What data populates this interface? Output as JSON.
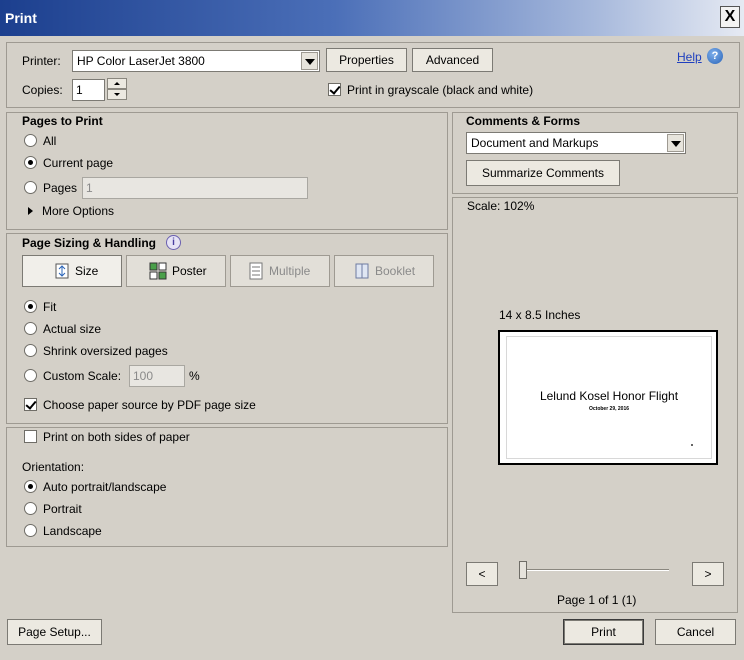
{
  "window": {
    "title": "Print",
    "close_glyph": "X"
  },
  "header": {
    "printer_label": "Printer:",
    "printer_value": "HP Color LaserJet 3800",
    "properties_label": "Properties",
    "advanced_label": "Advanced",
    "help_label": "Help",
    "help_glyph": "?",
    "copies_label": "Copies:",
    "copies_value": "1",
    "grayscale_label": "Print in grayscale (black and white)",
    "grayscale_checked": true
  },
  "pages_to_print": {
    "title": "Pages to Print",
    "options": [
      {
        "label": "All",
        "selected": false
      },
      {
        "label": "Current page",
        "selected": true
      },
      {
        "label": "Pages",
        "selected": false
      }
    ],
    "pages_value": "1",
    "more_options_label": "More Options"
  },
  "page_sizing": {
    "title": "Page Sizing & Handling",
    "info_glyph": "i",
    "modes": [
      {
        "label": "Size",
        "icon": "size-icon",
        "active": true,
        "enabled": true
      },
      {
        "label": "Poster",
        "icon": "poster-icon",
        "active": false,
        "enabled": true
      },
      {
        "label": "Multiple",
        "icon": "multiple-icon",
        "active": false,
        "enabled": false
      },
      {
        "label": "Booklet",
        "icon": "booklet-icon",
        "active": false,
        "enabled": false
      }
    ],
    "scale_options": [
      {
        "label": "Fit",
        "selected": true
      },
      {
        "label": "Actual size",
        "selected": false
      },
      {
        "label": "Shrink oversized pages",
        "selected": false
      },
      {
        "label": "Custom Scale:",
        "selected": false
      }
    ],
    "custom_scale_value": "100",
    "percent_label": "%",
    "paper_source_label": "Choose paper source by PDF page size",
    "paper_source_checked": true
  },
  "duplex": {
    "both_sides_label": "Print on both sides of paper",
    "both_sides_checked": false,
    "orientation_label": "Orientation:",
    "orientation_options": [
      {
        "label": "Auto portrait/landscape",
        "selected": true
      },
      {
        "label": "Portrait",
        "selected": false
      },
      {
        "label": "Landscape",
        "selected": false
      }
    ]
  },
  "comments_forms": {
    "title": "Comments & Forms",
    "value": "Document and Markups",
    "summarize_label": "Summarize Comments"
  },
  "preview": {
    "scale_label": "Scale: 102%",
    "page_size_label": "14 x 8.5 Inches",
    "doc_title": "Lelund Kosel Honor Flight",
    "doc_date": "October 29, 2016",
    "prev_glyph": "<",
    "next_glyph": ">",
    "page_status": "Page 1 of 1 (1)",
    "page_slider_fraction": 0
  },
  "footer": {
    "page_setup_label": "Page Setup...",
    "print_label": "Print",
    "cancel_label": "Cancel"
  },
  "colors": {
    "dialog_bg": "#d4d0c8",
    "titlebar_start": "#1c3f8e",
    "link": "#1f3fbf"
  }
}
